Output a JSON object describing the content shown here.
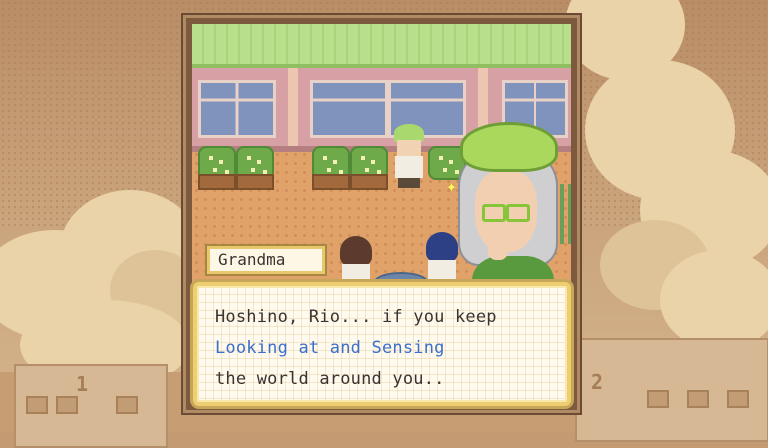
{
  "dialog": {
    "speaker": "Grandma",
    "lines": [
      {
        "text": "Hoshino, Rio... if you keep",
        "color": "#3b3330"
      },
      {
        "text": "Looking at and Sensing",
        "color": "#3c6fc9"
      },
      {
        "text": "the world around you..",
        "color": "#3b3330"
      }
    ]
  },
  "background": {
    "building_numbers": [
      "1",
      "2"
    ]
  },
  "colors": {
    "frame_border": "#b08a62",
    "dialog_border": "#edcf72",
    "highlight_text": "#3c6fc9"
  }
}
